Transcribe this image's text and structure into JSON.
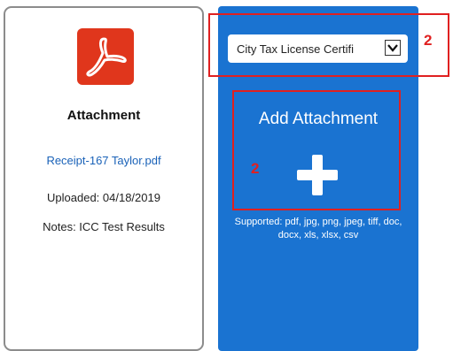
{
  "attachment_card": {
    "icon": "pdf-icon",
    "title": "Attachment",
    "file_name": "Receipt-167 Taylor.pdf",
    "uploaded": "Uploaded: 04/18/2019",
    "notes": "Notes: ICC Test Results"
  },
  "upload_panel": {
    "document_type_value": "City Tax License Certifi",
    "add_title": "Add Attachment",
    "add_icon": "plus-icon",
    "supported_text": "Supported: pdf, jpg, png, jpeg, tiff, doc, docx, xls, xlsx, csv"
  },
  "annotations": {
    "label_1": "2",
    "label_2": "2"
  },
  "colors": {
    "panel_blue": "#1a73d1",
    "pdf_red": "#e0361c",
    "annotation_red": "#e02020",
    "link_blue": "#1a62b8"
  }
}
